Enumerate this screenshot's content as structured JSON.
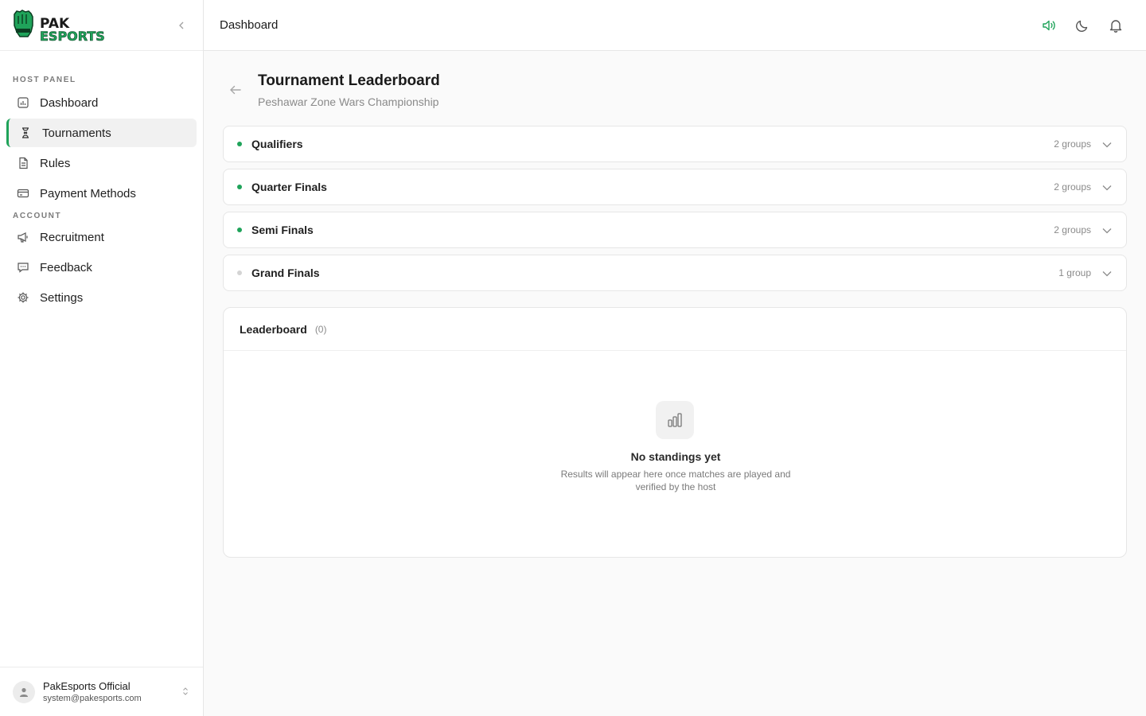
{
  "brand": {
    "line1": "PAK",
    "line2": "ESPORTS",
    "accent": "#1fa35a"
  },
  "topbar": {
    "title": "Dashboard"
  },
  "sidebar": {
    "sections": [
      {
        "label": "HOST PANEL"
      },
      {
        "label": "ACCOUNT"
      }
    ],
    "items": [
      {
        "label": "Dashboard",
        "icon": "chart-icon"
      },
      {
        "label": "Tournaments",
        "icon": "trophy-icon",
        "active": true
      },
      {
        "label": "Rules",
        "icon": "document-icon"
      },
      {
        "label": "Payment Methods",
        "icon": "credit-card-icon"
      },
      {
        "label": "Recruitment",
        "icon": "megaphone-icon"
      },
      {
        "label": "Feedback",
        "icon": "message-icon"
      },
      {
        "label": "Settings",
        "icon": "gear-icon"
      }
    ],
    "user": {
      "name": "PakEsports Official",
      "email": "system@pakesports.com"
    }
  },
  "page": {
    "title": "Tournament Leaderboard",
    "subtitle": "Peshawar Zone Wars Championship"
  },
  "stages": [
    {
      "name": "Qualifiers",
      "count": "2 groups",
      "status_color": "#1fa35a"
    },
    {
      "name": "Quarter Finals",
      "count": "2 groups",
      "status_color": "#1fa35a"
    },
    {
      "name": "Semi Finals",
      "count": "2 groups",
      "status_color": "#1fa35a"
    },
    {
      "name": "Grand Finals",
      "count": "1 group",
      "status_color": "#d4d4d4"
    }
  ],
  "leaderboard": {
    "title": "Leaderboard",
    "count": "(0)",
    "empty_title": "No standings yet",
    "empty_desc": "Results will appear here once matches are played and verified by the host"
  }
}
